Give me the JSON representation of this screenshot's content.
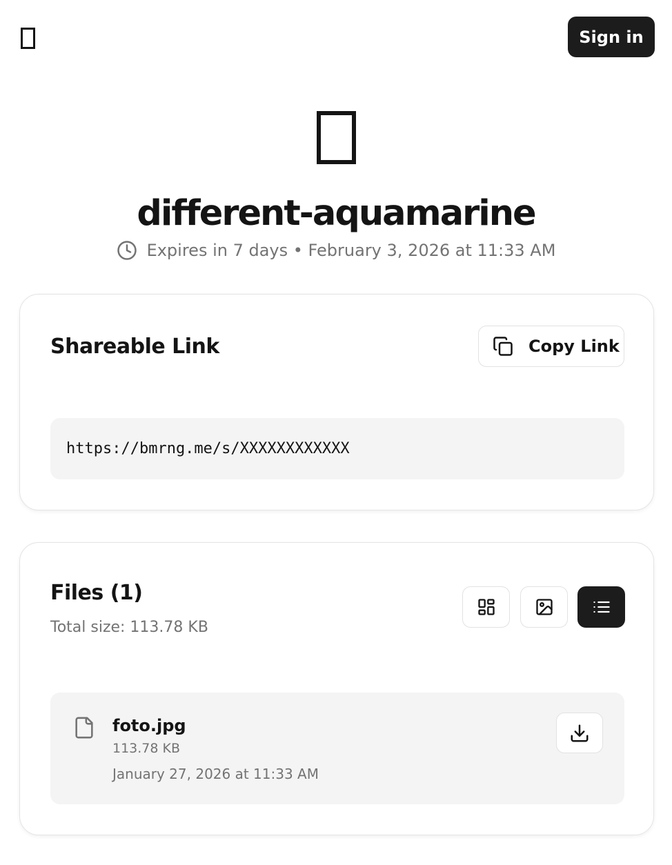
{
  "header": {
    "logo_icon": "missing-glyph-icon",
    "signin_label": "Sign in"
  },
  "hero": {
    "icon": "missing-glyph-icon",
    "share_name": "different-aquamarine",
    "expiry_icon": "clock-icon",
    "expiry_text": "Expires in 7 days • February 3, 2026 at 11:33 AM"
  },
  "link_card": {
    "title": "Shareable Link",
    "copy_label": "Copy Link",
    "copy_icon": "copy-icon",
    "url": "https://bmrng.me/s/XXXXXXXXXXXX"
  },
  "files_card": {
    "title": "Files (1)",
    "total_size": "Total size: 113.78 KB",
    "view_modes": [
      {
        "icon": "grid-view-icon",
        "active": false
      },
      {
        "icon": "image-view-icon",
        "active": false
      },
      {
        "icon": "list-view-icon",
        "active": true
      }
    ],
    "files": [
      {
        "icon": "file-icon",
        "name": "foto.jpg",
        "size": "113.78 KB",
        "date": "January 27, 2026 at 11:33 AM",
        "download_icon": "download-icon"
      }
    ]
  },
  "colors": {
    "primary_dark": "#1c1c1c",
    "text": "#141414",
    "muted": "#737373",
    "surface": "#f4f4f4",
    "border": "#e2e2e2"
  }
}
